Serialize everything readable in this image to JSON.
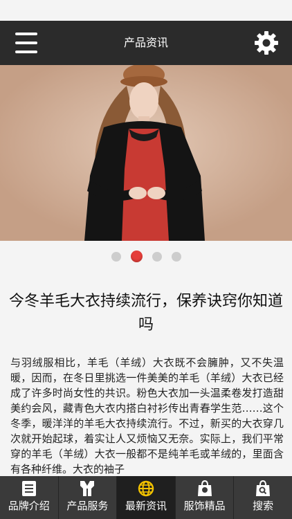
{
  "header": {
    "title": "产品资讯",
    "menu_icon": "menu-icon",
    "settings_icon": "gear-icon"
  },
  "carousel": {
    "dot_count": 4,
    "active_index": 1
  },
  "article": {
    "title": "今冬羊毛大衣持续流行，保养诀窍你知道吗",
    "body": "与羽绒服相比，羊毛（羊绒）大衣既不会臃肿，又不失温暖，因而，在冬日里挑选一件美美的羊毛（羊绒）大衣已经成了许多时尚女性的共识。粉色大衣加一头温柔卷发打造甜美约会风，藏青色大衣内搭白衬衫传出青春学生范……这个冬季，暖洋洋的羊毛大衣持续流行。不过，新买的大衣穿几次就开始起球，着实让人又烦恼又无奈。实际上，我们平常穿的羊毛（羊绒）大衣一般都不是纯羊毛或羊绒的，里面含有各种纤维。大衣的袖子"
  },
  "bottom_nav": {
    "items": [
      {
        "label": "品牌介绍",
        "icon": "book-icon"
      },
      {
        "label": "产品服务",
        "icon": "vest-icon"
      },
      {
        "label": "最新资讯",
        "icon": "globe-icon"
      },
      {
        "label": "服饰精品",
        "icon": "bag-icon"
      },
      {
        "label": "搜索",
        "icon": "search-bag-icon"
      }
    ],
    "active_index": 2
  },
  "colors": {
    "header_bg": "#2b2b2b",
    "nav_bg": "#3a3a3a",
    "nav_active_bg": "#1f1f1f",
    "dot_active": "#e53e3a",
    "dot_inactive": "#cdcdcd"
  }
}
